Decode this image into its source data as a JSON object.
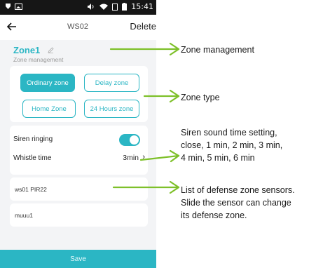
{
  "statusbar": {
    "time": "15:41"
  },
  "navbar": {
    "title": "WS02",
    "delete_label": "Delete"
  },
  "zone": {
    "title": "Zone1",
    "subtitle": "Zone management"
  },
  "zone_types": {
    "ordinary": "Ordinary zone",
    "delay": "Delay zone",
    "home": "Home Zone",
    "hours24": "24 Hours zone",
    "selected": "Ordinary zone"
  },
  "siren": {
    "label": "Siren ringing",
    "enabled": true
  },
  "whistle": {
    "label": "Whistle time",
    "value": "3min",
    "chevron": "›"
  },
  "sensors": {
    "items": [
      "ws01 PIR22",
      "muuu1"
    ]
  },
  "save_label": "Save",
  "annotations": {
    "zone_management": "Zone management",
    "zone_type": "Zone type",
    "siren_lines": [
      "Siren sound time setting,",
      "close, 1 min, 2 min, 3 min,",
      "4 min, 5 min, 6 min"
    ],
    "sensors_lines": [
      "List of defense zone sensors.",
      "Slide the sensor can change",
      "its defense zone."
    ]
  },
  "colors": {
    "accent": "#2bb6c4",
    "arrow": "#7ec02a",
    "statusbar": "#161616"
  }
}
